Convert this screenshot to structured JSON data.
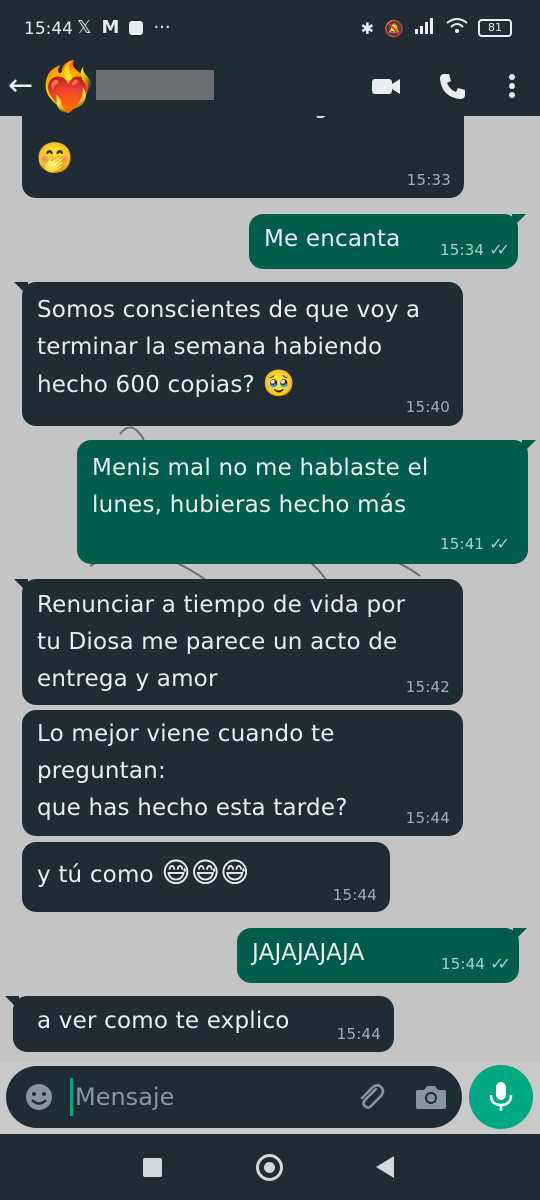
{
  "status_bar": {
    "time": "15:44",
    "left_icons": [
      "x-icon",
      "gmail-icon",
      "notification-square-icon",
      "more-dots-icon"
    ],
    "battery": "81"
  },
  "header": {
    "avatar": "❤️‍🔥",
    "contact_name": "",
    "icons": [
      "back-arrow-icon",
      "video-call-icon",
      "phone-icon",
      "menu-icon"
    ]
  },
  "messages": [
    {
      "direction": "in",
      "text": "ha tenido suerte esa le gusta",
      "emoji": "🤭",
      "time": "15:33"
    },
    {
      "direction": "out",
      "text": "Me encanta",
      "time": "15:34",
      "read": true
    },
    {
      "direction": "in",
      "text": "Somos conscientes de que voy a\nterminar la semana habiendo\nhecho 600 copias?",
      "emoji": "🥹",
      "time": "15:40"
    },
    {
      "direction": "out",
      "text": "Menis mal no me hablaste el\nlunes, hubieras hecho más",
      "time": "15:41",
      "read": true
    },
    {
      "direction": "in",
      "text": "Renunciar a tiempo de vida por\ntu Diosa me parece un acto de\nentrega y amor",
      "time": "15:42"
    },
    {
      "direction": "in",
      "text": "Lo mejor viene cuando te\npreguntan:\nque has hecho esta tarde?",
      "time": "15:44"
    },
    {
      "direction": "in",
      "text": "y tú como",
      "emoji": "😅😅😅",
      "time": "15:44"
    },
    {
      "direction": "out",
      "text": "JAJAJAJAJA",
      "time": "15:44",
      "read": true
    },
    {
      "direction": "in",
      "text": "a ver como te explico",
      "time": "15:44"
    }
  ],
  "input": {
    "placeholder": "Mensaje"
  },
  "colors": {
    "incoming_bubble": "#1f2c34",
    "outgoing_bubble": "#005c4b",
    "accent": "#00a884"
  }
}
